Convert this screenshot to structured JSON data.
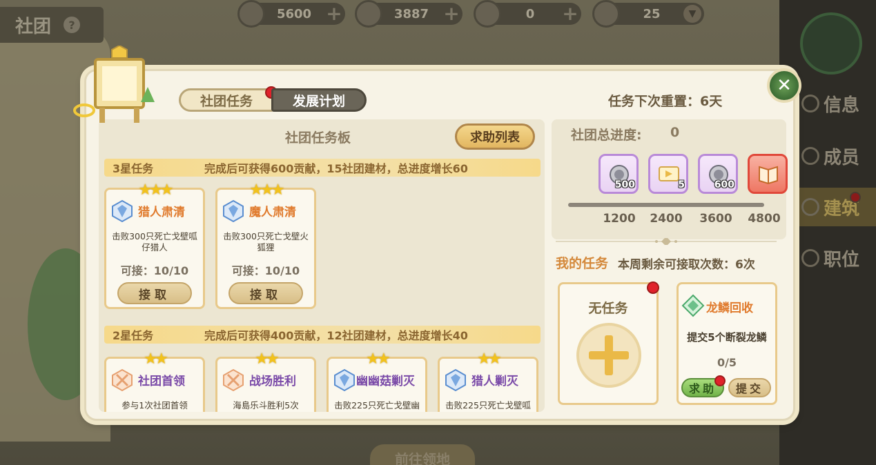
{
  "header": {
    "club_title": "社团",
    "help_icon": "?",
    "currencies": [
      {
        "icon": "silver-medal-icon",
        "value": "5600"
      },
      {
        "icon": "blue-coin-icon",
        "value": "3887"
      },
      {
        "icon": "gold-coin-icon",
        "value": "0"
      },
      {
        "icon": "gem-icon",
        "value": "25"
      }
    ]
  },
  "sidebar": {
    "items": [
      {
        "label": "信息",
        "icon": "info-icon"
      },
      {
        "label": "成员",
        "icon": "members-icon"
      },
      {
        "label": "建筑",
        "icon": "building-icon",
        "active": true
      },
      {
        "label": "职位",
        "icon": "position-icon"
      }
    ]
  },
  "footer": {
    "goto_label": "前往领地"
  },
  "dialog": {
    "tabs": [
      {
        "label": "社团任务",
        "active": true
      },
      {
        "label": "发展计划",
        "active": false
      }
    ],
    "reset_text": "任务下次重置：6天",
    "board": {
      "title": "社团任务板",
      "help_list_label": "求助列表",
      "tiers": [
        {
          "name": "3星任务",
          "reward": "完成后可获得600贡献，15社团建材，总进度增长60",
          "stars": "★★★",
          "cards": [
            {
              "name": "猎人肃清",
              "desc": "击败300只死亡戈壁呱仔猎人",
              "avail": "可接：10/10",
              "accept": "接取",
              "color": "#e07a2c"
            },
            {
              "name": "魔人肃清",
              "desc": "击败300只死亡戈壁火狐狸",
              "avail": "可接：10/10",
              "accept": "接取",
              "color": "#e07a2c"
            }
          ]
        },
        {
          "name": "2星任务",
          "reward": "完成后可获得400贡献，12社团建材，总进度增长40",
          "stars": "★★",
          "cards": [
            {
              "name": "社团首领",
              "desc": "参与1次社团首领",
              "color": "#7a4aa8"
            },
            {
              "name": "战场胜利",
              "desc": "海島乐斗胜利5次",
              "color": "#7a4aa8"
            },
            {
              "name": "幽幽菇剿灭",
              "desc": "击败225只死亡戈壁幽",
              "color": "#7a4aa8"
            },
            {
              "name": "猎人剿灭",
              "desc": "击败225只死亡戈壁呱",
              "color": "#7a4aa8"
            }
          ]
        }
      ]
    },
    "progress": {
      "label": "社团总进度:",
      "value": "0",
      "fraction": 0,
      "rewards": [
        {
          "icon": "silver-medal-icon",
          "qty": "500",
          "threshold": "1200"
        },
        {
          "icon": "ticket-icon",
          "qty": "5",
          "threshold": "2400"
        },
        {
          "icon": "silver-medal-icon",
          "qty": "600",
          "threshold": "3600"
        },
        {
          "icon": "book-icon",
          "qty": "",
          "threshold": "4800"
        }
      ]
    },
    "my_tasks": {
      "title": "我的任务",
      "remaining": "本周剩余可接取次数：6次",
      "empty_label": "无任务",
      "active_task": {
        "name": "龙鳞回收",
        "desc": "提交5个断裂龙鳞",
        "count": "0/5",
        "help_label": "求助",
        "submit_label": "提交"
      }
    }
  },
  "colors": {
    "accent_gold": "#eab947",
    "badge_red": "#e0222b",
    "tier_bar": "#f6d98a",
    "title_orange": "#e07a2c"
  }
}
